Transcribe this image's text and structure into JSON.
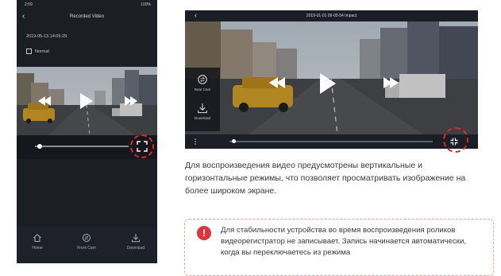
{
  "portrait": {
    "status_time": "2:09",
    "status_right": "100%",
    "title": "Recorded Video",
    "timestamp": "2019-05-13 14:05:29",
    "mode": "Normal",
    "seek_progress": 0.05,
    "nav": [
      {
        "label": "Home",
        "icon": "home-icon"
      },
      {
        "label": "Front Cam",
        "icon": "camera-switch-icon"
      },
      {
        "label": "Download",
        "icon": "download-icon"
      }
    ]
  },
  "landscape": {
    "title": "2019-01-01 09-05-54 Impact",
    "side_menu": [
      {
        "label": "Rear Cam",
        "icon": "camera-switch-icon"
      },
      {
        "label": "Download",
        "icon": "download-icon"
      }
    ],
    "seek_progress": 0.02
  },
  "description": "Для воспроизведения видео предусмотрены вертикальные и горизонтальные режимы, что позволяет просматривать изображение на более широком экране.",
  "note": {
    "icon": "!",
    "text": "Для стабильности устройства во время воспроизведения роликов видеорегистратор не записывает. Запись начинается автоматически, когда вы переключаетесь из режима"
  },
  "colors": {
    "accent_red": "#e1252c",
    "phone_bg": "#1b1e25"
  }
}
